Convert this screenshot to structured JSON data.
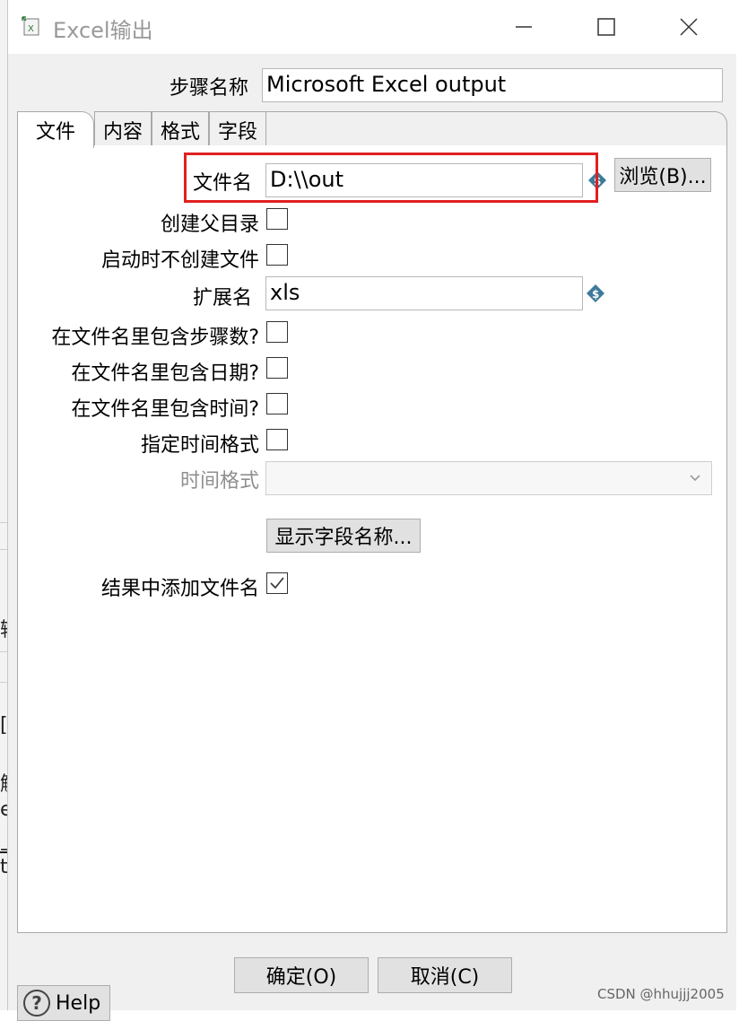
{
  "window": {
    "title": "Excel输出"
  },
  "step": {
    "label": "步骤名称",
    "value": "Microsoft Excel output"
  },
  "tabs": [
    {
      "label": "文件",
      "active": true
    },
    {
      "label": "内容",
      "active": false
    },
    {
      "label": "格式",
      "active": false
    },
    {
      "label": "字段",
      "active": false
    }
  ],
  "file_tab": {
    "filename": {
      "label": "文件名",
      "value": "D:\\\\out"
    },
    "browse_label": "浏览(B)...",
    "create_parent": {
      "label": "创建父目录",
      "checked": false
    },
    "no_create_on_start": {
      "label": "启动时不创建文件",
      "checked": false
    },
    "extension": {
      "label": "扩展名",
      "value": "xls"
    },
    "include_stepnr": {
      "label": "在文件名里包含步骤数?",
      "checked": false
    },
    "include_date": {
      "label": "在文件名里包含日期?",
      "checked": false
    },
    "include_time": {
      "label": "在文件名里包含时间?",
      "checked": false
    },
    "specify_format": {
      "label": "指定时间格式",
      "checked": false
    },
    "time_format": {
      "label": "时间格式",
      "value": "",
      "disabled": true
    },
    "show_fields_label": "显示字段名称...",
    "add_to_result": {
      "label": "结果中添加文件名",
      "checked": true
    }
  },
  "footer": {
    "ok_label": "确定(O)",
    "cancel_label": "取消(C)",
    "help_label": "Help"
  },
  "watermark": "CSDN @hhujjj2005",
  "background_fragments": [
    "输",
    "[",
    "解",
    "e",
    "上",
    "t"
  ],
  "colors": {
    "highlight": "#e02020",
    "var_icon": "#3d7a9a"
  },
  "icons": {
    "app": "excel-icon",
    "variable": "dollar-diamond-icon",
    "help": "question-icon",
    "dropdown": "chevron-down-icon",
    "checked": "checkmark-icon"
  }
}
